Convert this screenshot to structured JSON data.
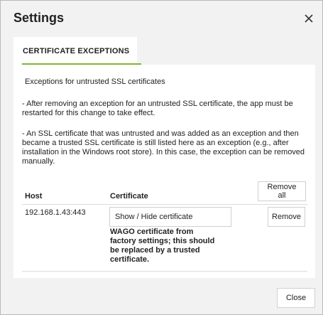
{
  "dialog": {
    "title": "Settings",
    "close_icon": "close-icon"
  },
  "tabs": [
    {
      "label": "CERTIFICATE EXCEPTIONS",
      "active": true
    }
  ],
  "colors": {
    "accent": "#7cb82f",
    "panel_bg": "#ffffff",
    "dialog_bg": "#f2f2f2"
  },
  "content": {
    "heading": "Exceptions for untrusted SSL certificates",
    "paragraph1": "- After removing an exception for an untrusted SSL certificate, the app must be restarted for this change to take effect.",
    "paragraph2": "- An SSL certificate that was untrusted and was added as an exception and then became a trusted SSL certificate is still listed here as an exception (e.g., after installation in the Windows root store). In this case, the exception can be removed manually."
  },
  "table": {
    "columns": [
      "Host",
      "Certificate"
    ],
    "remove_all_label": "Remove all",
    "rows": [
      {
        "host": "192.168.1.43:443",
        "show_hide_label": "Show / Hide certificate",
        "remove_label": "Remove",
        "note": "WAGO certificate from factory settings; this should be replaced by a trusted certificate."
      }
    ]
  },
  "footer": {
    "close_label": "Close"
  }
}
